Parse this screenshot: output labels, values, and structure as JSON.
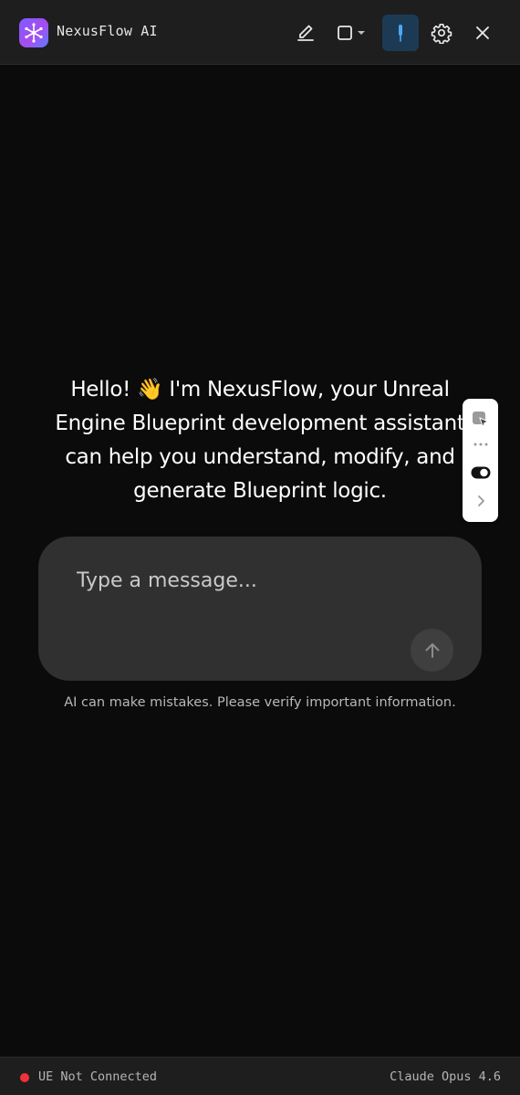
{
  "app": {
    "title": "NexusFlow AI"
  },
  "welcome": {
    "lines": [
      "Hello! 👋 I'm NexusFlow, your Unreal",
      "Engine Blueprint development assistant",
      "can help you understand, modify, and",
      "generate Blueprint logic."
    ]
  },
  "composer": {
    "placeholder": "Type a message..."
  },
  "disclaimer": "AI can make mistakes. Please verify important information.",
  "status": {
    "connection": "UE Not Connected",
    "model": "Claude Opus 4.6"
  },
  "colors": {
    "accent": "#1d3a54",
    "pin": "#4aa8ff",
    "status_error": "#f0313b",
    "logo_start": "#7b5cff",
    "logo_end": "#5f7dff"
  },
  "icons": {
    "logo": "network-star-icon",
    "edit": "pencil-icon",
    "stop": "square-icon",
    "pin": "pin-icon",
    "settings": "gear-icon",
    "close": "close-icon",
    "send": "arrow-up-icon"
  }
}
